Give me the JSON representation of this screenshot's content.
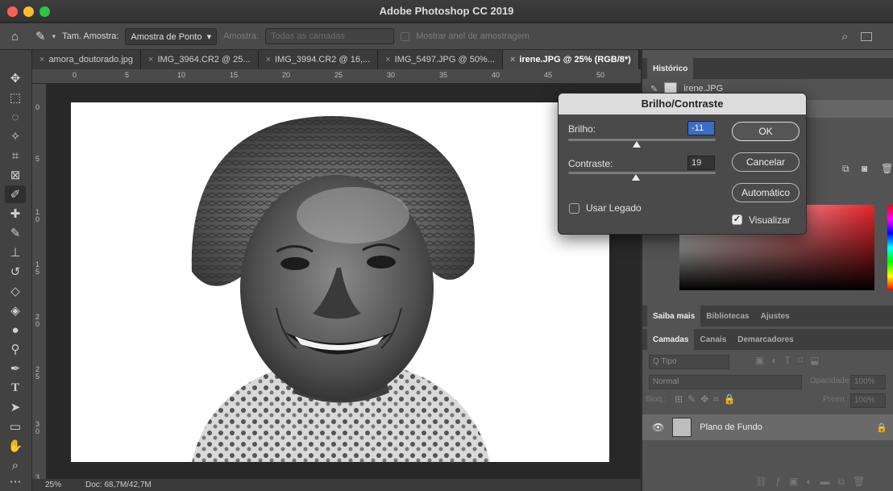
{
  "window": {
    "title": "Adobe Photoshop CC 2019"
  },
  "options_bar": {
    "sample_size_label": "Tam. Amostra:",
    "sample_size_value": "Amostra de Ponto",
    "sample_label": "Amostra:",
    "sample_value": "Todas as camadas",
    "ring_label": "Mostrar anel de amostragem"
  },
  "tabs": [
    {
      "label": "amora_doutorado.jpg"
    },
    {
      "label": "IMG_3964.CR2 @ 25..."
    },
    {
      "label": "IMG_3994.CR2 @ 16,..."
    },
    {
      "label": "IMG_5497.JPG @ 50%..."
    },
    {
      "label": "irene.JPG @ 25% (RGB/8*)"
    }
  ],
  "ruler_h": [
    "0",
    "5",
    "10",
    "15",
    "20",
    "25",
    "30",
    "35",
    "40",
    "45",
    "50"
  ],
  "ruler_v": [
    "0",
    "5",
    "1\n0",
    "1\n5",
    "2\n0",
    "2\n5",
    "3\n0",
    "3"
  ],
  "status": {
    "zoom": "25%",
    "doc": "Doc: 68,7M/42,7M"
  },
  "history_panel": {
    "tab": "Histórico",
    "item": "irene.JPG"
  },
  "dialog": {
    "title": "Brilho/Contraste",
    "brightness_label": "Brilho:",
    "brightness_value": "-11",
    "brightness_level": -11,
    "contrast_label": "Contraste:",
    "contrast_value": "19",
    "contrast_level": 19,
    "ok": "OK",
    "cancel": "Cancelar",
    "auto": "Automático",
    "legacy": "Usar Legado",
    "preview": "Visualizar"
  },
  "learn_tabs": {
    "a": "Saiba mais",
    "b": "Bibliotecas",
    "c": "Ajustes"
  },
  "layers_tabs": {
    "a": "Camadas",
    "b": "Canais",
    "c": "Demarcadores"
  },
  "layers": {
    "filter": "Q Tipo",
    "blend": "Normal",
    "opacity_label": "Opacidade:",
    "opacity_value": "100%",
    "lock_label": "Bloq.:",
    "fill_label": "Preen.:",
    "fill_value": "100%",
    "layer_name": "Plano de Fundo"
  },
  "colors": {
    "red": "#e8242d",
    "accent": "#3b7ed8"
  }
}
